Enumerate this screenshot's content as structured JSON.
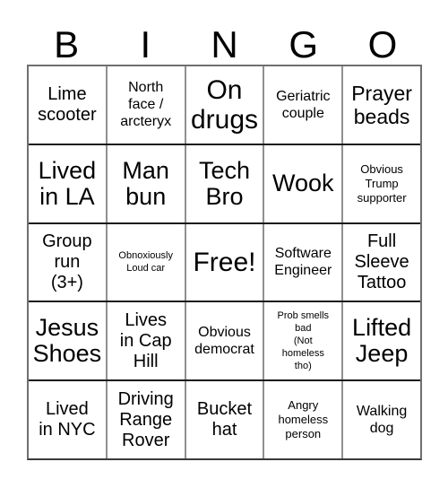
{
  "card": {
    "title": "BINGO",
    "header_letters": [
      "B",
      "I",
      "N",
      "G",
      "O"
    ],
    "columns": 5,
    "rows": 5,
    "free_space_label": "Free!",
    "colors": {
      "background": "#ffffff",
      "text": "#000000",
      "grid_line_vertical": "#909090",
      "grid_line_horizontal": "#1a1a1a",
      "grid_outer_border": "#6f6f6f"
    },
    "cells": [
      [
        {
          "text": "Lime\nscooter",
          "size": "md",
          "free": false
        },
        {
          "text": "North\nface /\narcteryx",
          "size": "sm",
          "free": false
        },
        {
          "text": "On\ndrugs",
          "size": "xxl",
          "free": false
        },
        {
          "text": "Geriatric\ncouple",
          "size": "sm",
          "free": false
        },
        {
          "text": "Prayer\nbeads",
          "size": "lg",
          "free": false
        }
      ],
      [
        {
          "text": "Lived\nin LA",
          "size": "xl",
          "free": false
        },
        {
          "text": "Man\nbun",
          "size": "xl",
          "free": false
        },
        {
          "text": "Tech\nBro",
          "size": "xl",
          "free": false
        },
        {
          "text": "Wook",
          "size": "xl",
          "free": false
        },
        {
          "text": "Obvious\nTrump\nsupporter",
          "size": "xs",
          "free": false
        }
      ],
      [
        {
          "text": "Group\nrun\n(3+)",
          "size": "md",
          "free": false
        },
        {
          "text": "Obnoxiously\nLoud car",
          "size": "xxs",
          "free": false
        },
        {
          "text": "Free!",
          "size": "xxl",
          "free": true
        },
        {
          "text": "Software\nEngineer",
          "size": "sm",
          "free": false
        },
        {
          "text": "Full\nSleeve\nTattoo",
          "size": "md",
          "free": false
        }
      ],
      [
        {
          "text": "Jesus\nShoes",
          "size": "xl",
          "free": false
        },
        {
          "text": "Lives\nin Cap\nHill",
          "size": "md",
          "free": false
        },
        {
          "text": "Obvious\ndemocrat",
          "size": "sm",
          "free": false
        },
        {
          "text": "Prob smells\nbad\n(Not\nhomeless\ntho)",
          "size": "xxs",
          "free": false
        },
        {
          "text": "Lifted\nJeep",
          "size": "xl",
          "free": false
        }
      ],
      [
        {
          "text": "Lived\nin NYC",
          "size": "md",
          "free": false
        },
        {
          "text": "Driving\nRange\nRover",
          "size": "md",
          "free": false
        },
        {
          "text": "Bucket\nhat",
          "size": "md",
          "free": false
        },
        {
          "text": "Angry\nhomeless\nperson",
          "size": "xs",
          "free": false
        },
        {
          "text": "Walking\ndog",
          "size": "sm",
          "free": false
        }
      ]
    ]
  }
}
